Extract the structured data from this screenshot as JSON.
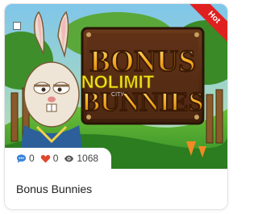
{
  "card": {
    "game_title": "Bonus Bunnies",
    "logo_text": {
      "line1": "BONUS",
      "line2": "BUNNIES",
      "provider": "NOLIMIT",
      "provider_sub": "CITY"
    },
    "badge": "Hot",
    "stats": {
      "comments": "0",
      "likes": "0",
      "views": "1068"
    },
    "colors": {
      "badge": "#e02020",
      "comment_icon": "#3b86d9",
      "like_icon": "#e0482c",
      "view_icon": "#555555"
    }
  }
}
